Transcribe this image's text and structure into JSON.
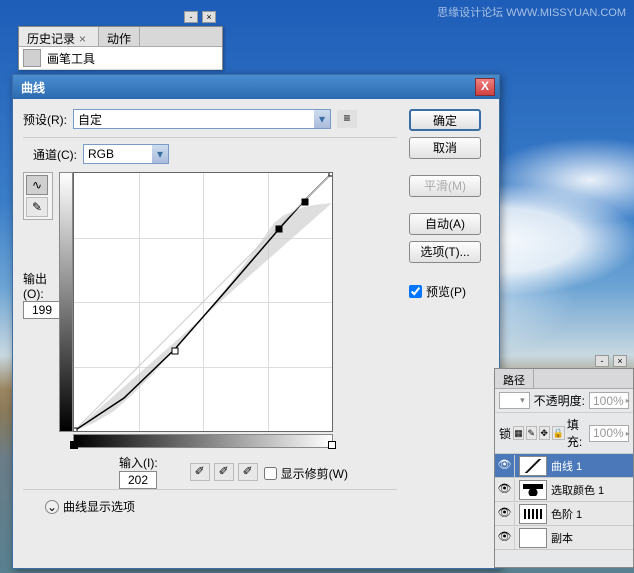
{
  "watermark": "思缘设计论坛 WWW.MISSYUAN.COM",
  "history": {
    "tab1": "历史记录",
    "tab2": "动作",
    "item": "画笔工具"
  },
  "dialog": {
    "title": "曲线",
    "preset_label": "预设(R):",
    "preset_value": "自定",
    "channel_label": "通道(C):",
    "channel_value": "RGB",
    "output_label": "输出(O):",
    "output_value": "199",
    "input_label": "输入(I):",
    "input_value": "202",
    "show_clip": "显示修剪(W)",
    "options_toggle": "曲线显示选项",
    "buttons": {
      "ok": "确定",
      "cancel": "取消",
      "smooth": "平滑(M)",
      "auto": "自动(A)",
      "options": "选项(T)..."
    },
    "preview_label": "预览(P)"
  },
  "layers": {
    "tab_paths": "路径",
    "opacity_label": "不透明度:",
    "opacity_value": "100%",
    "fill_label": "填充:",
    "fill_value": "100%",
    "lock_label": "锁",
    "items": [
      {
        "name": "曲线 1"
      },
      {
        "name": "选取颜色 1"
      },
      {
        "name": "色阶 1"
      },
      {
        "name": "副本"
      }
    ]
  },
  "chart_data": {
    "type": "line",
    "title": "Curves Adjustment (RGB)",
    "xlabel": "Input",
    "ylabel": "Output",
    "xlim": [
      0,
      255
    ],
    "ylim": [
      0,
      255
    ],
    "series": [
      {
        "name": "curve",
        "x": [
          0,
          100,
          202,
          228,
          255
        ],
        "y": [
          0,
          80,
          199,
          225,
          255
        ]
      }
    ],
    "control_points": [
      {
        "x": 0,
        "y": 0
      },
      {
        "x": 100,
        "y": 80
      },
      {
        "x": 202,
        "y": 199
      },
      {
        "x": 228,
        "y": 225
      },
      {
        "x": 255,
        "y": 255
      }
    ],
    "selected_point": {
      "input": 202,
      "output": 199
    }
  }
}
